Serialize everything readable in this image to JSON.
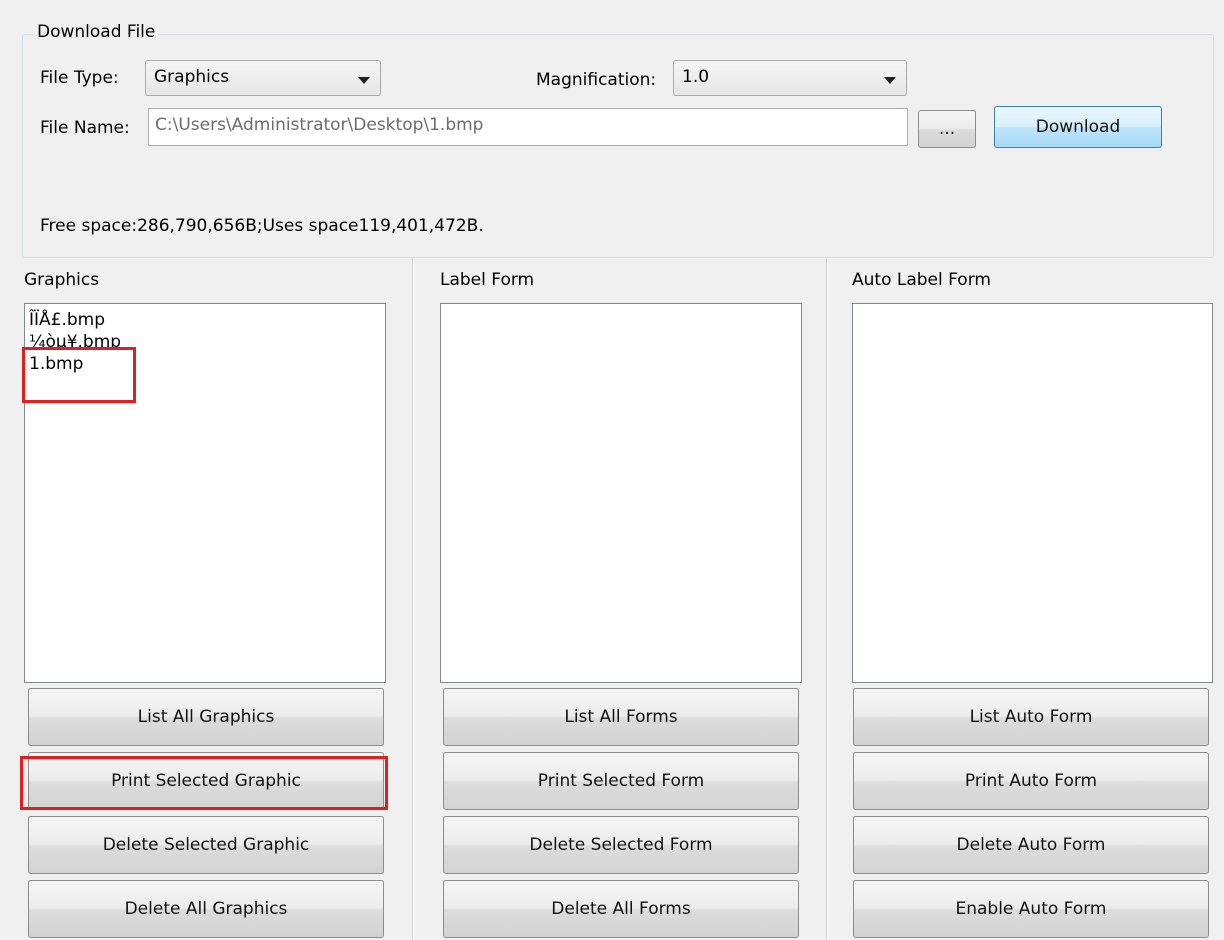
{
  "download": {
    "group_title": "Download File",
    "file_type_label": "File Type:",
    "file_type_value": "Graphics",
    "magnification_label": "Magnification:",
    "magnification_value": "1.0",
    "file_name_label": "File Name:",
    "file_name_value": "C:\\Users\\Administrator\\Desktop\\1.bmp",
    "browse_label": "...",
    "download_label": "Download",
    "space_info": "Free space:286,790,656B;Uses space119,401,472B."
  },
  "graphics": {
    "title": "Graphics",
    "items": [
      "ÎÏÅ£.bmp",
      "¼òµ¥.bmp",
      "1.bmp"
    ],
    "buttons": [
      "List All Graphics",
      "Print Selected Graphic",
      "Delete Selected Graphic",
      "Delete All Graphics"
    ]
  },
  "label_form": {
    "title": "Label Form",
    "buttons": [
      "List All Forms",
      "Print Selected Form",
      "Delete Selected Form",
      "Delete All Forms"
    ]
  },
  "auto_label_form": {
    "title": "Auto Label Form",
    "buttons": [
      "List Auto Form",
      "Print Auto Form",
      "Delete Auto Form",
      "Enable Auto Form"
    ]
  },
  "colors": {
    "highlight": "#e02020",
    "download_button": "#bee6fd"
  }
}
